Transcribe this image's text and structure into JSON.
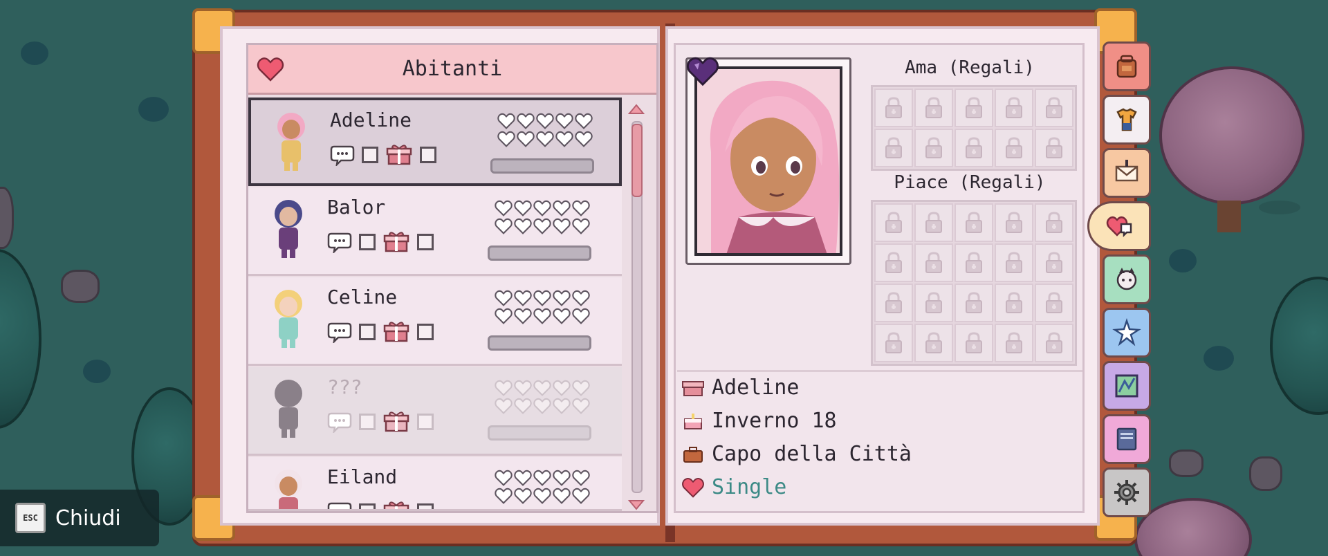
{
  "list": {
    "title": "Abitanti",
    "residents": [
      {
        "name": "Adeline",
        "hearts_filled": 0,
        "talked": false,
        "gifted": false,
        "selected": true,
        "known": true
      },
      {
        "name": "Balor",
        "hearts_filled": 0,
        "talked": false,
        "gifted": false,
        "selected": false,
        "known": true
      },
      {
        "name": "Celine",
        "hearts_filled": 0,
        "talked": false,
        "gifted": false,
        "selected": false,
        "known": true
      },
      {
        "name": "???",
        "hearts_filled": 0,
        "talked": false,
        "gifted": false,
        "selected": false,
        "known": false
      },
      {
        "name": "Eiland",
        "hearts_filled": 0,
        "talked": false,
        "gifted": false,
        "selected": false,
        "known": true
      }
    ],
    "max_hearts": 10
  },
  "detail": {
    "loves_label": "Ama (Regali)",
    "likes_label": "Piace (Regali)",
    "loves_slots": 10,
    "likes_slots": 20,
    "name": "Adeline",
    "birthday": "Inverno 18",
    "occupation": "Capo della Città",
    "status": "Single"
  },
  "tabs": [
    {
      "name": "backpack-icon",
      "color": "#f08f86"
    },
    {
      "name": "shirt-icon",
      "color": "#f4eef2"
    },
    {
      "name": "mail-icon",
      "color": "#f7c8a2"
    },
    {
      "name": "relationships-icon",
      "color": "#fbe3b8",
      "active": true
    },
    {
      "name": "animal-icon",
      "color": "#a7dfc0"
    },
    {
      "name": "skills-icon",
      "color": "#9cc6f0"
    },
    {
      "name": "map-icon",
      "color": "#c7a9e6"
    },
    {
      "name": "journal-icon",
      "color": "#f0a9d8"
    },
    {
      "name": "settings-icon",
      "color": "#c8c6c6"
    }
  ],
  "close": {
    "key": "ESC",
    "label": "Chiudi"
  },
  "colors": {
    "accent": "#f7c7cc",
    "status": "#3c8a86",
    "book_cover": "#b1583c"
  }
}
